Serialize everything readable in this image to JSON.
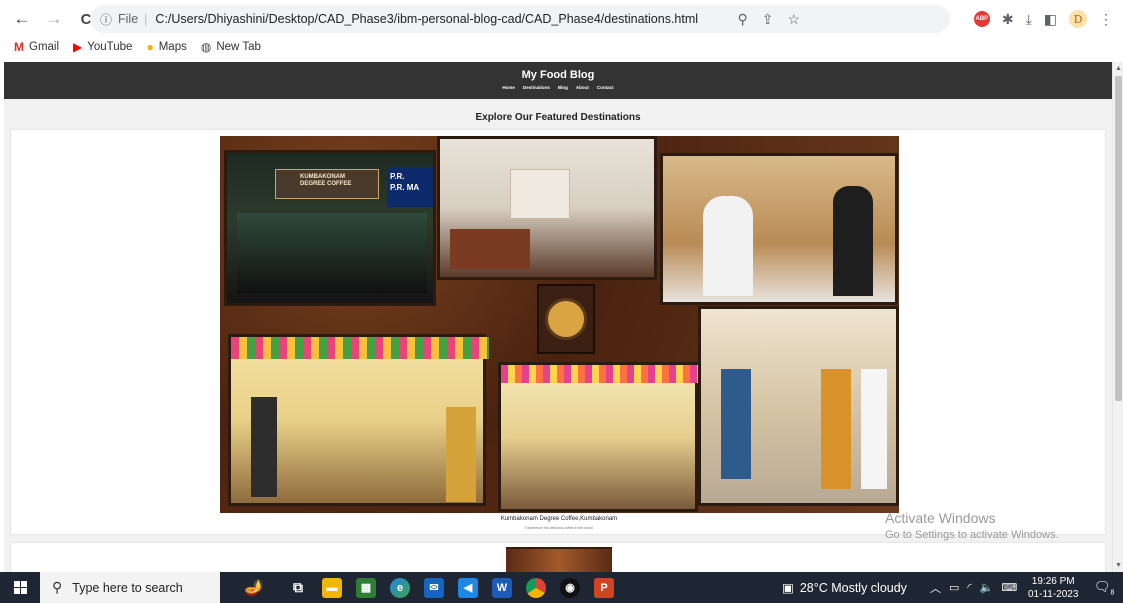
{
  "browser": {
    "nav": {
      "back": "←",
      "forward": "→",
      "reload": "C"
    },
    "address": {
      "scheme": "File",
      "url": "C:/Users/Dhiyashini/Desktop/CAD_Phase3/ibm-personal-blog-cad/CAD_Phase4/destinations.html"
    },
    "profile_initial": "D",
    "bookmarks": [
      {
        "label": "Gmail",
        "icon": "gmail-icon",
        "color": "#d93025"
      },
      {
        "label": "YouTube",
        "icon": "youtube-icon",
        "color": "#ff0000"
      },
      {
        "label": "Maps",
        "icon": "maps-icon",
        "color": "#1a73e8"
      },
      {
        "label": "New Tab",
        "icon": "globe-icon",
        "color": "#444444"
      }
    ]
  },
  "site": {
    "title": "My Food Blog",
    "nav": [
      "Home",
      "Destinations",
      "Blog",
      "About",
      "Contact"
    ],
    "section_heading": "Explore Our Featured Destinations",
    "destination": {
      "caption": "Kumbakonam Degree Coffee,Kumbakonam",
      "subcaption": "Experience the delicious coffee in the world",
      "sign_text": [
        "KUMBAKONAM",
        "DEGREE COFFEE"
      ],
      "shop_sign": [
        "P.R.",
        "P.R. MA"
      ]
    }
  },
  "watermark": {
    "line1": "Activate Windows",
    "line2": "Go to Settings to activate Windows."
  },
  "taskbar": {
    "search_placeholder": "Type here to search",
    "weather": "28°C  Mostly cloudy",
    "time": "19:26 PM",
    "date": "01-11-2023",
    "notifications": "8"
  },
  "colors": {
    "header_bg": "#333333",
    "taskbar_bg": "#1f2633",
    "accent": "#1a73e8"
  }
}
